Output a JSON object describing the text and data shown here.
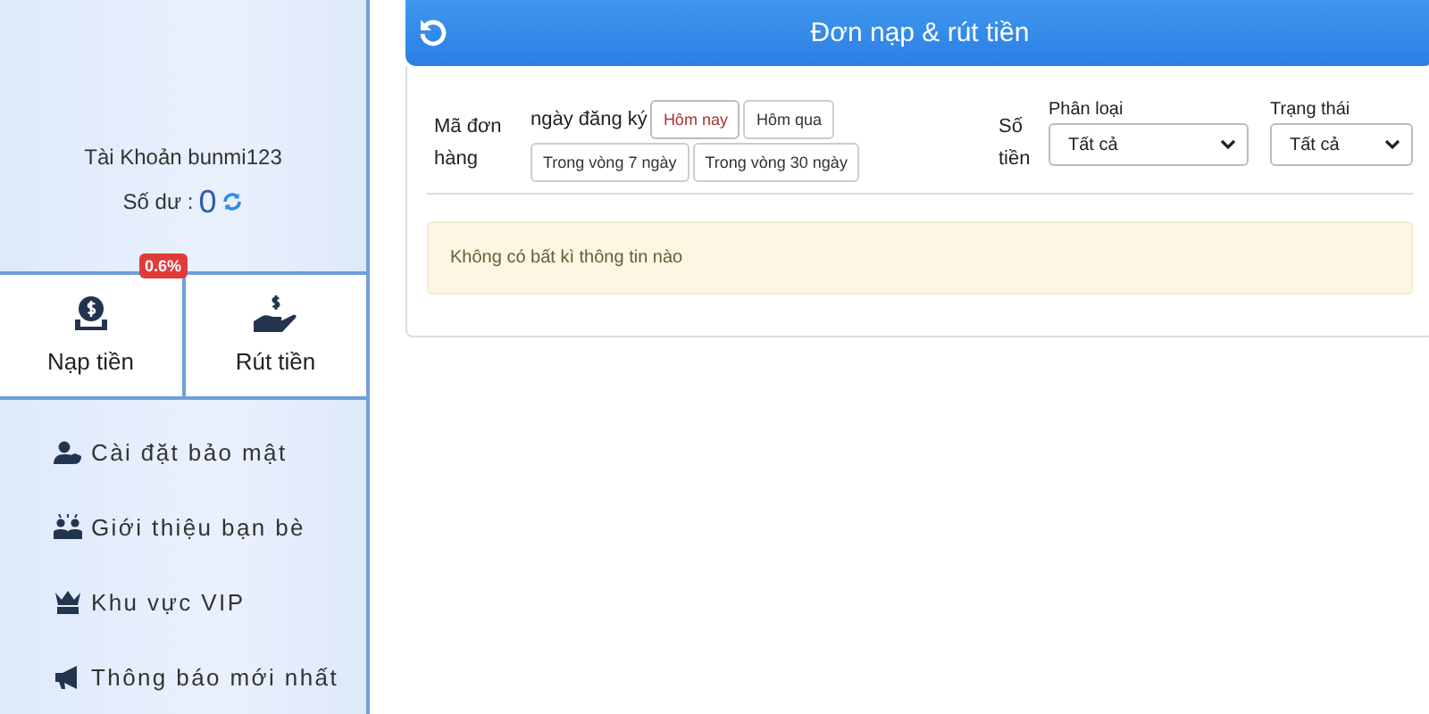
{
  "account": {
    "label": "Tài Khoản bunmi123",
    "balance_label": "Số dư :",
    "balance": "0"
  },
  "actions": [
    {
      "kind": "deposit",
      "label": "Nạp tiền",
      "badge": "0.6%"
    },
    {
      "kind": "withdraw",
      "label": "Rút tiền"
    }
  ],
  "menu": [
    {
      "kind": "security",
      "label": "Cài đặt bảo mật"
    },
    {
      "kind": "referral",
      "label": "Giới thiệu bạn bè"
    },
    {
      "kind": "vip",
      "label": "Khu vực VIP"
    },
    {
      "kind": "notice",
      "label": "Thông báo mới nhất"
    }
  ],
  "header": {
    "title": "Đơn nạp & rút tiền"
  },
  "filters": {
    "order_label": "Mã đơn hàng",
    "date_label": "ngày đăng ký",
    "dates": [
      {
        "label": "Hôm nay",
        "selected": true
      },
      {
        "label": "Hôm qua",
        "selected": false
      },
      {
        "label": "Trong vòng 7 ngày",
        "selected": false
      },
      {
        "label": "Trong vòng 30 ngày",
        "selected": false
      }
    ],
    "amount_label": "Số tiền",
    "selects": [
      {
        "label": "Phân loại",
        "value": "Tất cả"
      },
      {
        "label": "Trạng thái",
        "value": "Tất cả"
      }
    ]
  },
  "empty_message": "Không có bất kì thông tin nào"
}
